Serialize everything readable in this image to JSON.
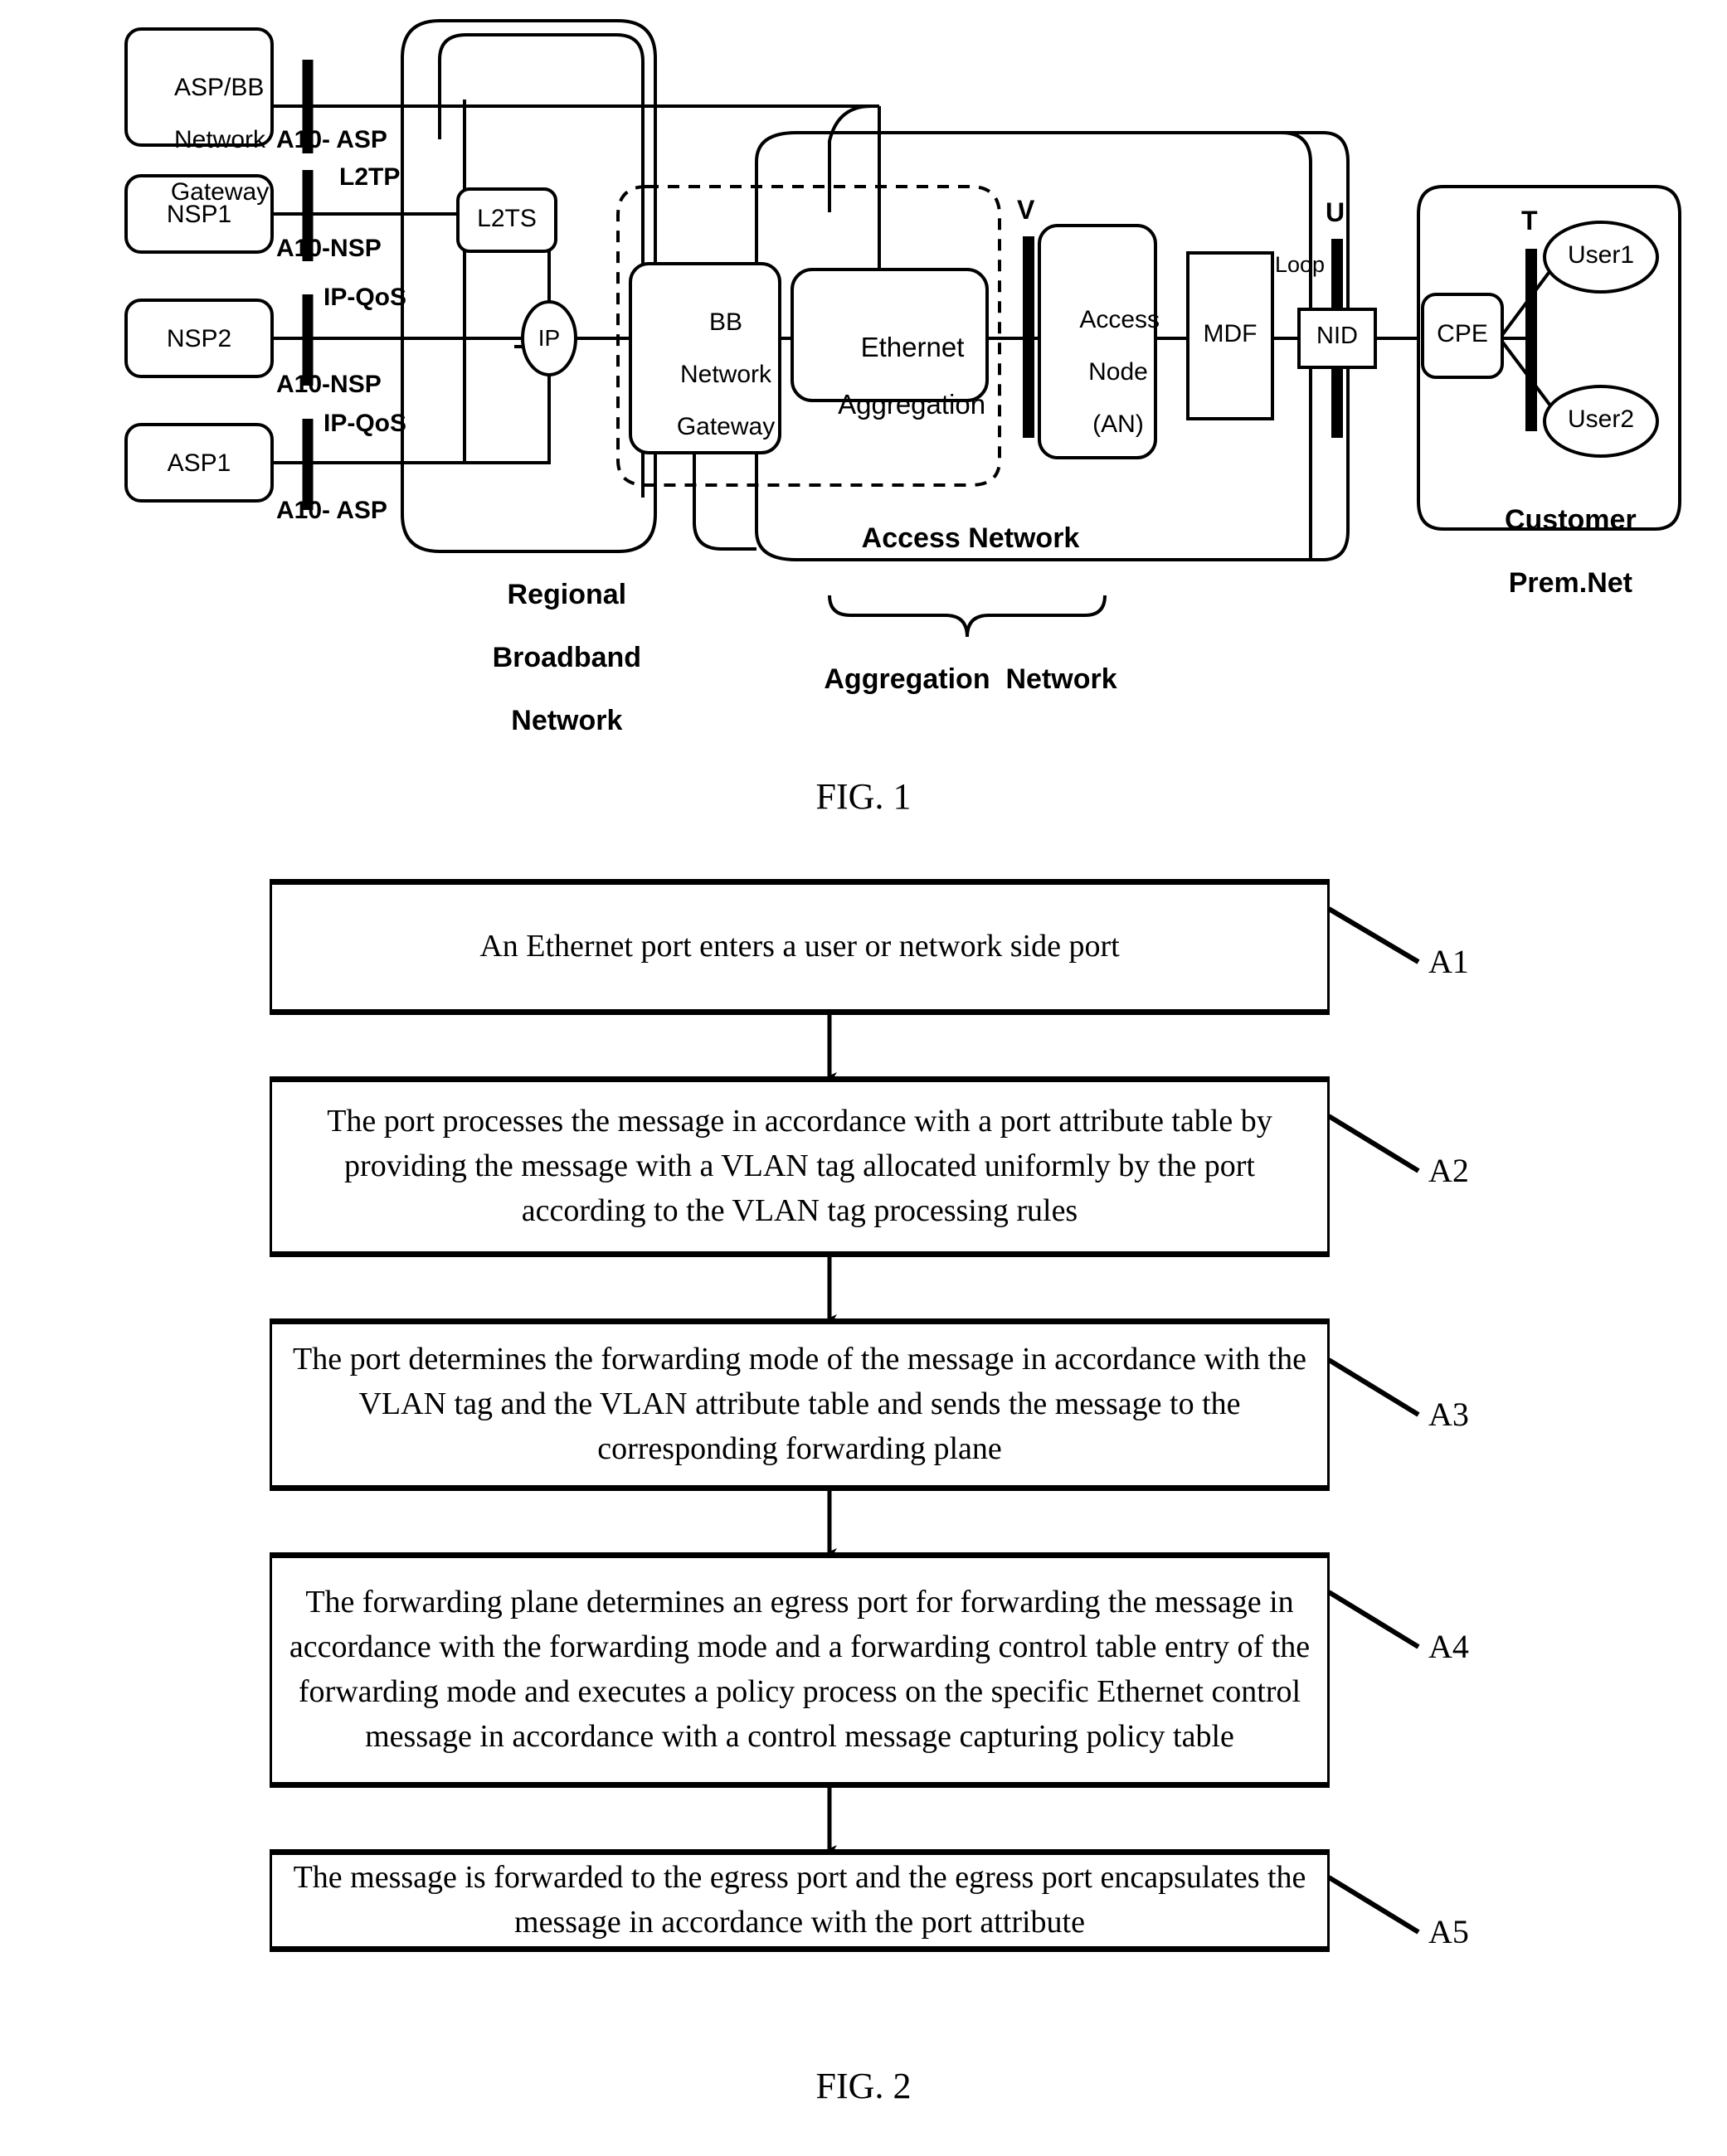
{
  "figure1": {
    "caption": "FIG. 1",
    "providers": [
      {
        "id": "asp-bb-network-gateway",
        "lines": [
          "ASP/BB",
          "Network",
          "Gateway"
        ]
      },
      {
        "id": "nsp1",
        "lines": [
          "NSP1"
        ]
      },
      {
        "id": "nsp2",
        "lines": [
          "NSP2"
        ]
      },
      {
        "id": "asp1",
        "lines": [
          "ASP1"
        ]
      }
    ],
    "interfaces": [
      {
        "id": "a10-asp-top",
        "label": "A10- ASP"
      },
      {
        "id": "l2tp",
        "label": "L2TP"
      },
      {
        "id": "a10-nsp-1",
        "label": "A10-NSP"
      },
      {
        "id": "ip-qos-1",
        "label": "IP-QoS"
      },
      {
        "id": "a10-nsp-2",
        "label": "A10-NSP"
      },
      {
        "id": "ip-qos-2",
        "label": "IP-QoS"
      },
      {
        "id": "a10-asp-bottom",
        "label": "A10- ASP"
      }
    ],
    "nodes": {
      "l2ts": "L2TS",
      "ip": "IP",
      "bb_network_gateway": [
        "BB",
        "Network",
        "Gateway"
      ],
      "ethernet_aggregation": [
        "Ethernet",
        "Aggregation"
      ],
      "access_node": [
        "Access",
        "Node",
        "(AN)"
      ],
      "mdf": "MDF",
      "nid": "NID",
      "cpe": "CPE",
      "user1": "User1",
      "user2": "User2"
    },
    "reference_points": {
      "v": "V",
      "u": "U",
      "t": "T",
      "loop": "Loop"
    },
    "zones": {
      "regional_broadband_network": [
        "Regional",
        "Broadband",
        "Network"
      ],
      "access_network": "Access Network",
      "aggregation_network": "Aggregation  Network",
      "customer_premises_network": [
        "Customer",
        "Prem.Net"
      ]
    }
  },
  "figure2": {
    "caption": "FIG. 2",
    "steps": [
      {
        "ref": "A1",
        "text": "An Ethernet port enters a user or network side port"
      },
      {
        "ref": "A2",
        "text": "The port processes the message in accordance with a port attribute table by providing the message with a VLAN tag allocated uniformly by the port according to the VLAN tag processing rules"
      },
      {
        "ref": "A3",
        "text": "The port determines the forwarding mode of the message in accordance with the VLAN tag and the VLAN attribute table  and sends the message to the corresponding forwarding plane"
      },
      {
        "ref": "A4",
        "text": "The forwarding plane determines an egress port for forwarding the message in accordance with the forwarding mode and a forwarding control table entry of the forwarding mode and executes a policy process on the specific Ethernet control message in accordance with a control message capturing policy table"
      },
      {
        "ref": "A5",
        "text": "The message is forwarded to the egress port and the egress port encapsulates the message in accordance with the port attribute"
      }
    ]
  },
  "colors": {
    "stroke": "#000000",
    "background": "#ffffff"
  }
}
